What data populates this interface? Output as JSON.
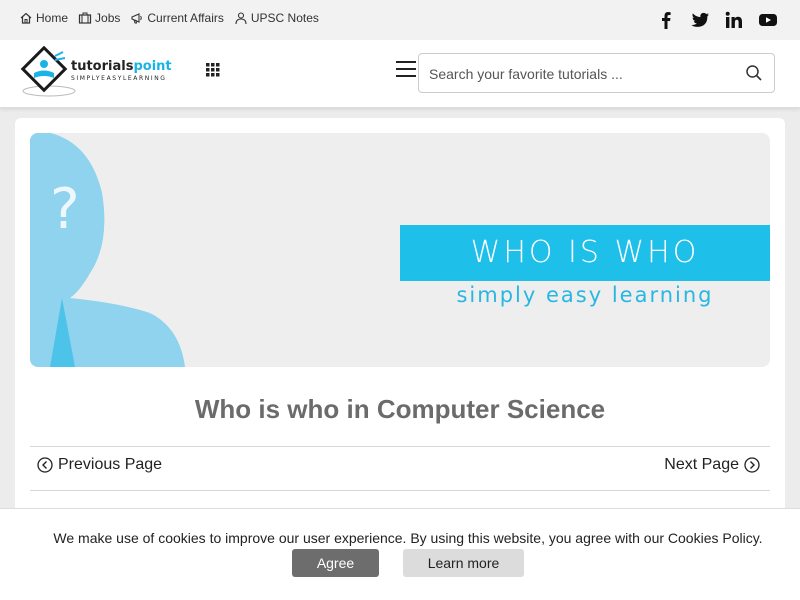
{
  "topbar": {
    "links": [
      {
        "label": "Home",
        "icon": "home-icon"
      },
      {
        "label": "Jobs",
        "icon": "briefcase-icon"
      },
      {
        "label": "Current Affairs",
        "icon": "megaphone-icon"
      },
      {
        "label": "UPSC Notes",
        "icon": "user-icon"
      }
    ],
    "social": [
      "facebook-icon",
      "twitter-icon",
      "linkedin-icon",
      "youtube-icon"
    ]
  },
  "header": {
    "search_placeholder": "Search your favorite tutorials ..."
  },
  "banner": {
    "title": "WHO IS WHO",
    "subtitle": "simply easy learning",
    "accent": "#1ec0ea"
  },
  "main": {
    "page_title": "Who is who in Computer Science",
    "prev_label": "Previous Page",
    "next_label": "Next Page"
  },
  "cookie": {
    "text": "We make use of cookies to improve our user experience. By using this website, you agree with our Cookies Policy.",
    "agree_label": "Agree",
    "learn_label": "Learn more"
  }
}
